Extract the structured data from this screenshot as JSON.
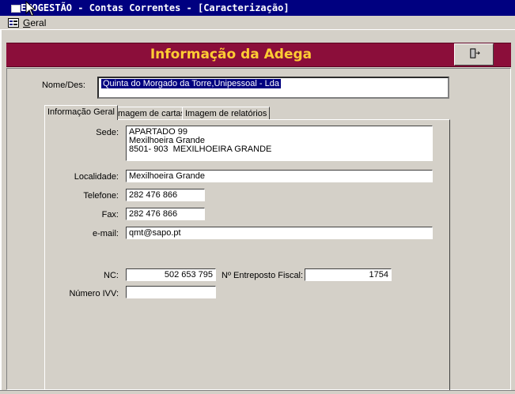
{
  "window": {
    "title": "ENOGESTÃO - Contas Correntes - [Caracterização]"
  },
  "menubar": {
    "items": [
      {
        "label_prefix": "",
        "accel": "G",
        "label_rest": "eral"
      }
    ]
  },
  "header": {
    "title": "Informação da Adega",
    "exit_icon": "exit-door-icon",
    "bar_color": "#8b0e3a",
    "title_color": "#ffcc33"
  },
  "form": {
    "nome_label": "Nome/Des:",
    "nome_value": "Quinta do Morgado da Torre,Unipessoal - Lda",
    "tabs": [
      {
        "label": "Informação Geral",
        "active": true
      },
      {
        "label": "Imagem de cartas",
        "active": false
      },
      {
        "label": "Imagem de relatórios",
        "active": false
      }
    ],
    "sede_label": "Sede:",
    "sede_value": "APARTADO 99\nMexilhoeira Grande\n8501- 903  MEXILHOEIRA GRANDE",
    "localidade_label": "Localidade:",
    "localidade_value": "Mexilhoeira Grande",
    "telefone_label": "Telefone:",
    "telefone_value": "282 476 866",
    "fax_label": "Fax:",
    "fax_value": "282 476 866",
    "email_label": "e-mail:",
    "email_value": "qmt@sapo.pt",
    "nc_label": "NC:",
    "nc_value": "502 653 795",
    "entreposto_label": "Nº Entreposto Fiscal:",
    "entreposto_value": "1754",
    "ivv_label": "Número IVV:",
    "ivv_value": ""
  }
}
